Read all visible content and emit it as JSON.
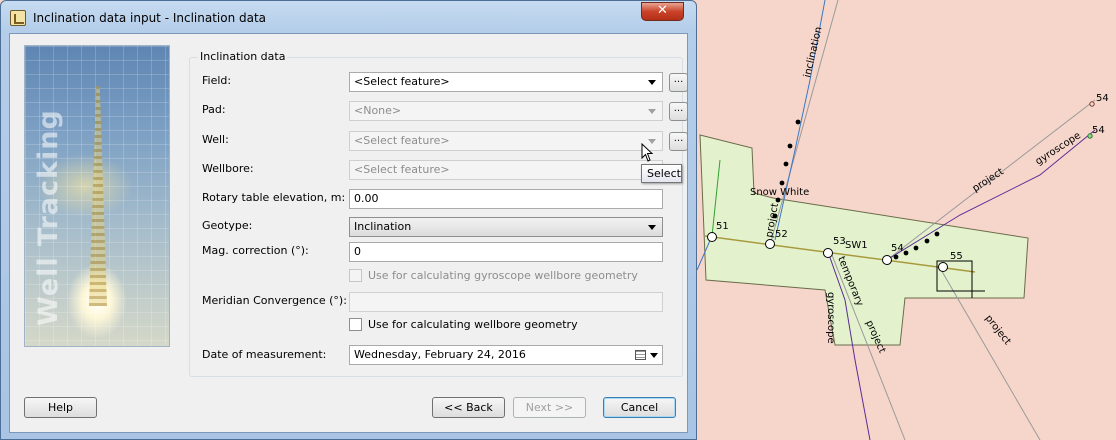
{
  "window": {
    "title": "Inclination data input - Inclination data",
    "close_label": "✕"
  },
  "banner": {
    "text": "Well Tracking"
  },
  "group": {
    "title": "Inclination data"
  },
  "fields": {
    "field_label": "Field:",
    "field_value": "<Select feature>",
    "pad_label": "Pad:",
    "pad_value": "<None>",
    "well_label": "Well:",
    "well_value": "<Select feature>",
    "wellbore_label": "Wellbore:",
    "wellbore_value": "<Select feature>",
    "rotary_label": "Rotary table elevation, m:",
    "rotary_value": "0.00",
    "geotype_label": "Geotype:",
    "geotype_value": "Inclination",
    "mag_label": "Mag. correction (°):",
    "mag_value": "0",
    "gyro_check_label": "Use for calculating gyroscope wellbore geometry",
    "meridian_label": "Meridian Convergence (°):",
    "meridian_value": "",
    "wellbore_check_label": "Use for calculating wellbore geometry",
    "date_label": "Date of measurement:",
    "date_value": "Wednesday,   February   24, 2016"
  },
  "browse_label": "...",
  "tooltip": {
    "text": "Select"
  },
  "buttons": {
    "help": "Help",
    "back": "<< Back",
    "next": "Next >>",
    "cancel": "Cancel"
  },
  "map": {
    "labels": {
      "inclination": "inclination",
      "project": "project",
      "snow_white": "Snow White",
      "gyroscope": "gyroscope",
      "temporary": "temporary",
      "sw1": "SW1",
      "n51": "51",
      "n52": "52",
      "n53": "53",
      "n54": "54",
      "n55": "55"
    }
  },
  "colors": {
    "map_background": "#f6d6cb",
    "well_area": "#e3f2cd",
    "trajectory_gray": "#9a9a9a",
    "trajectory_blue": "#3a78c8",
    "trajectory_purple": "#5a2c96",
    "trajectory_olive": "#a89a3c",
    "trajectory_green": "#2ea02e"
  }
}
